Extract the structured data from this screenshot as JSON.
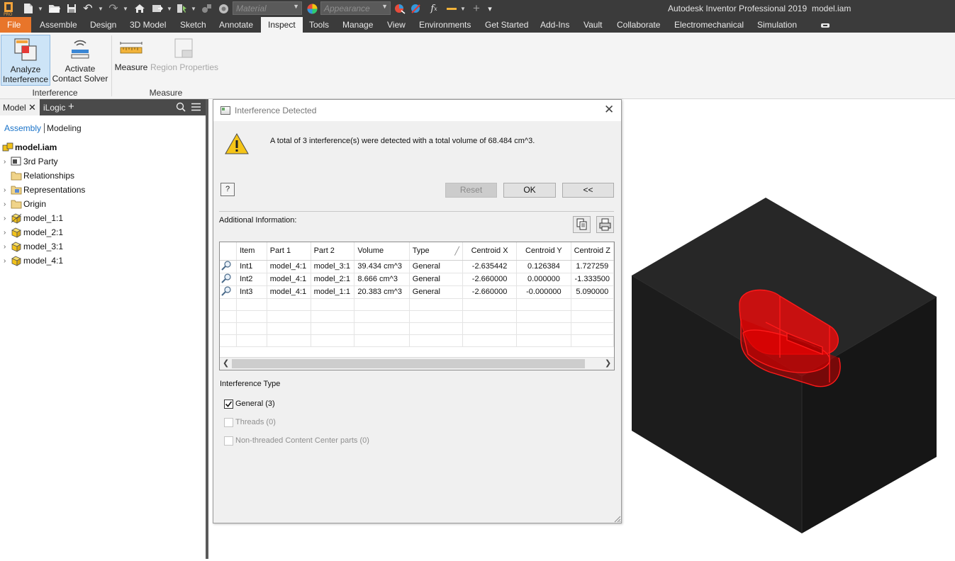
{
  "app": {
    "title": "Autodesk Inventor Professional 2019",
    "document": "model.iam"
  },
  "quick_access": {
    "material_placeholder": "Material",
    "appearance_placeholder": "Appearance",
    "icons": [
      "new-icon",
      "open-icon",
      "save-icon",
      "undo-icon",
      "redo-icon",
      "home-icon",
      "return-icon",
      "select-icon",
      "color-icon",
      "appearance-palette-icon",
      "clear-appearance-icon",
      "fx-icon",
      "line-weight-icon",
      "crosshair-icon",
      "customize-icon"
    ]
  },
  "ribbon": {
    "tabs": [
      "File",
      "Assemble",
      "Design",
      "3D Model",
      "Sketch",
      "Annotate",
      "Inspect",
      "Tools",
      "Manage",
      "View",
      "Environments",
      "Get Started",
      "Add-Ins",
      "Vault",
      "Collaborate",
      "Electromechanical",
      "Simulation"
    ],
    "active_tab": "Inspect",
    "buttons": {
      "analyze_line1": "Analyze",
      "analyze_line2": "Interference",
      "contact_line1": "Activate",
      "contact_line2": "Contact Solver",
      "measure": "Measure",
      "region": "Region Properties"
    },
    "panels": {
      "interference": "Interference",
      "measure": "Measure"
    },
    "accent_color": "#e8752a"
  },
  "browser": {
    "tab_model": "Model",
    "tab_ilogic": "iLogic",
    "mode_assembly": "Assembly",
    "mode_modeling": "Modeling",
    "root": "model.iam",
    "nodes": [
      "3rd Party",
      "Relationships",
      "Representations",
      "Origin",
      "model_1:1",
      "model_2:1",
      "model_3:1",
      "model_4:1"
    ]
  },
  "dialog": {
    "title": "Interference Detected",
    "message": "A total of 3 interference(s) were detected with a total volume of 68.484 cm^3.",
    "help_label": "?",
    "reset_label": "Reset",
    "ok_label": "OK",
    "collapse_label": "<<",
    "additional_info_label": "Additional Information:",
    "columns": [
      "Item",
      "Part 1",
      "Part 2",
      "Volume",
      "Type",
      "Centroid X",
      "Centroid Y",
      "Centroid Z"
    ],
    "rows": [
      {
        "item": "Int1",
        "part1": "model_4:1",
        "part2": "model_3:1",
        "volume": "39.434 cm^3",
        "type": "General",
        "cx": "-2.635442",
        "cy": "0.126384",
        "cz": "1.727259"
      },
      {
        "item": "Int2",
        "part1": "model_4:1",
        "part2": "model_2:1",
        "volume": "8.666 cm^3",
        "type": "General",
        "cx": "-2.660000",
        "cy": "0.000000",
        "cz": "-1.333500"
      },
      {
        "item": "Int3",
        "part1": "model_4:1",
        "part2": "model_1:1",
        "volume": "20.383 cm^3",
        "type": "General",
        "cx": "-2.660000",
        "cy": "-0.000000",
        "cz": "5.090000"
      }
    ],
    "interference_type_label": "Interference Type",
    "options": {
      "general": {
        "label": "General (3)",
        "checked": true,
        "enabled": true
      },
      "threads": {
        "label": "Threads (0)",
        "checked": false,
        "enabled": false
      },
      "non_threaded": {
        "label": "Non-threaded Content Center parts (0)",
        "checked": false,
        "enabled": false
      }
    }
  },
  "viewport": {
    "model_color": "#1c1c1c",
    "interference_color": "#ff0000"
  }
}
